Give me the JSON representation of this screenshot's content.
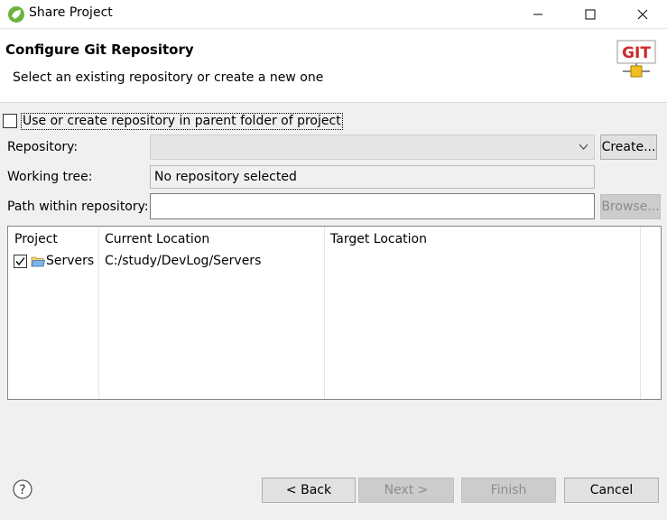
{
  "window": {
    "title": "Share Project"
  },
  "header": {
    "title": "Configure Git Repository",
    "description": "Select an existing repository or create a new one",
    "logo_text": "GIT"
  },
  "form": {
    "use_parent_label": "Use or create repository in parent folder of project",
    "use_parent_checked": false,
    "repository_label": "Repository:",
    "repository_value": "",
    "create_button": "Create...",
    "working_tree_label": "Working tree:",
    "working_tree_value": "No repository selected",
    "path_label": "Path within repository:",
    "path_value": "",
    "browse_button": "Browse..."
  },
  "table": {
    "columns": [
      "Project",
      "Current Location",
      "Target Location"
    ],
    "rows": [
      {
        "project": "Servers",
        "checked": true,
        "current_location": "C:/study/DevLog/Servers",
        "target_location": ""
      }
    ]
  },
  "footer": {
    "back": "< Back",
    "next": "Next >",
    "finish": "Finish",
    "cancel": "Cancel"
  },
  "colors": {
    "accent_green": "#6db33f",
    "dialog_bg": "#f0f0f0",
    "git_logo_red": "#cc2a2a"
  }
}
